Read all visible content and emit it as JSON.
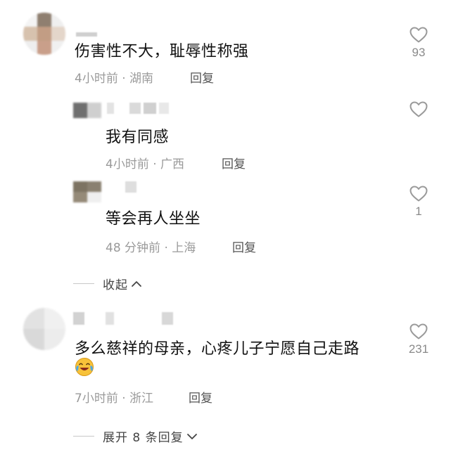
{
  "comments": [
    {
      "text": "伤害性不大，耻辱性称强",
      "time": "4小时前",
      "location": "湖南",
      "reply_label": "回复",
      "likes": "93"
    },
    {
      "text": "我有同感",
      "time": "4小时前",
      "location": "广西",
      "reply_label": "回复",
      "likes": ""
    },
    {
      "text": "等会再人坐坐",
      "time": "48 分钟前",
      "location": "上海",
      "reply_label": "回复",
      "likes": "1"
    },
    {
      "text": "多么慈祥的母亲，心疼儿子宁愿自己走路",
      "time": "7小时前",
      "location": "浙江",
      "reply_label": "回复",
      "likes": "231",
      "emoji": "laughing-crying-emoji"
    }
  ],
  "separator": "·",
  "collapse_label": "收起",
  "expand_label": "展开 8 条回复",
  "icons": {
    "like": "heart-outline-icon",
    "collapse": "chevron-up-icon",
    "expand": "chevron-down-icon"
  },
  "colors": {
    "text": "#111111",
    "meta": "#9a9a9a",
    "reply": "#555555",
    "icon": "#9a9a9a"
  }
}
